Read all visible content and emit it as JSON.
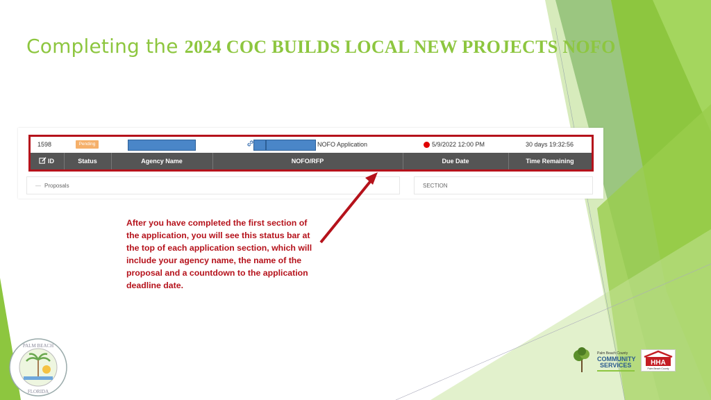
{
  "slide": {
    "title_prefix": "Completing the ",
    "title_rest": "2024 COC BUILDS LOCAL NEW PROJECTS NOFO",
    "caption": "After you have completed the first section of the application, you will see this status bar at the top of each application section, which will include your agency name, the name of the proposal and a countdown to the application deadline date."
  },
  "status_bar": {
    "id_value": "1598",
    "status_value": "Pending",
    "nofo_value": "NOFO Application",
    "due_date_value": "5/9/2022 12:00 PM",
    "time_remaining_value": "30 days 19:32:56",
    "headers": {
      "id": "ID",
      "status": "Status",
      "agency": "Agency Name",
      "nofo": "NOFO/RFP",
      "due": "Due Date",
      "time": "Time Remaining"
    }
  },
  "panels": {
    "proposals": "Proposals",
    "section": "SECTION"
  },
  "logos": {
    "seal_text": "PALM BEACH COUNTY FLORIDA",
    "pbc_text": "Palm Beach County COMMUNITY SERVICES",
    "hha_text": "HHA"
  },
  "colors": {
    "accent_green": "#8dc63f",
    "highlight_red": "#b5121b",
    "header_gray": "#555555",
    "redaction_blue": "#4a86c8",
    "pending_orange": "#f5b06a"
  }
}
